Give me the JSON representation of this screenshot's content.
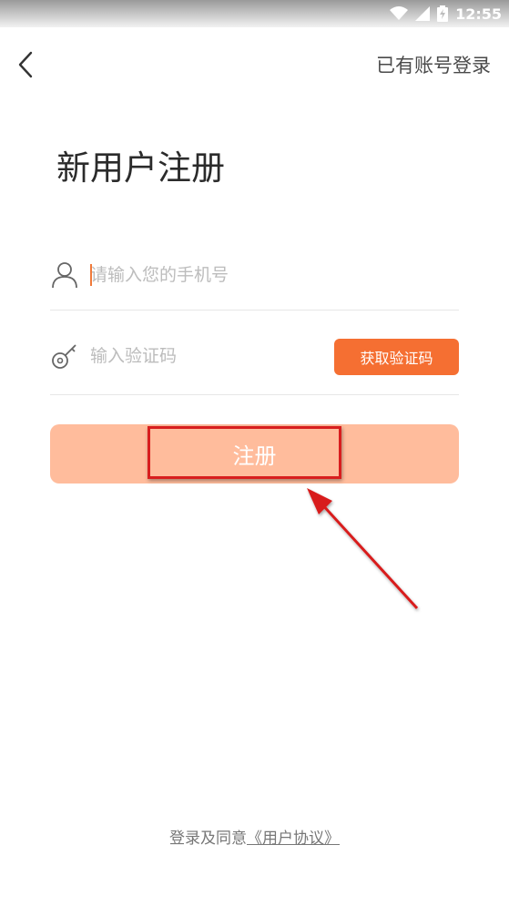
{
  "status_bar": {
    "time": "12:55"
  },
  "header": {
    "back_icon": "chevron-left-icon",
    "login_link": "已有账号登录"
  },
  "title": "新用户注册",
  "phone_field": {
    "icon": "user-icon",
    "placeholder": "请输入您的手机号",
    "value": ""
  },
  "code_field": {
    "icon": "key-icon",
    "placeholder": "输入验证码",
    "value": "",
    "button_label": "获取验证码"
  },
  "register_button": {
    "label": "注册"
  },
  "footer": {
    "prefix": "登录及同意",
    "link": "《用户协议》"
  },
  "colors": {
    "accent": "#f56f32",
    "register_bg": "#ffbc9c",
    "annotation": "#d81e1e"
  }
}
